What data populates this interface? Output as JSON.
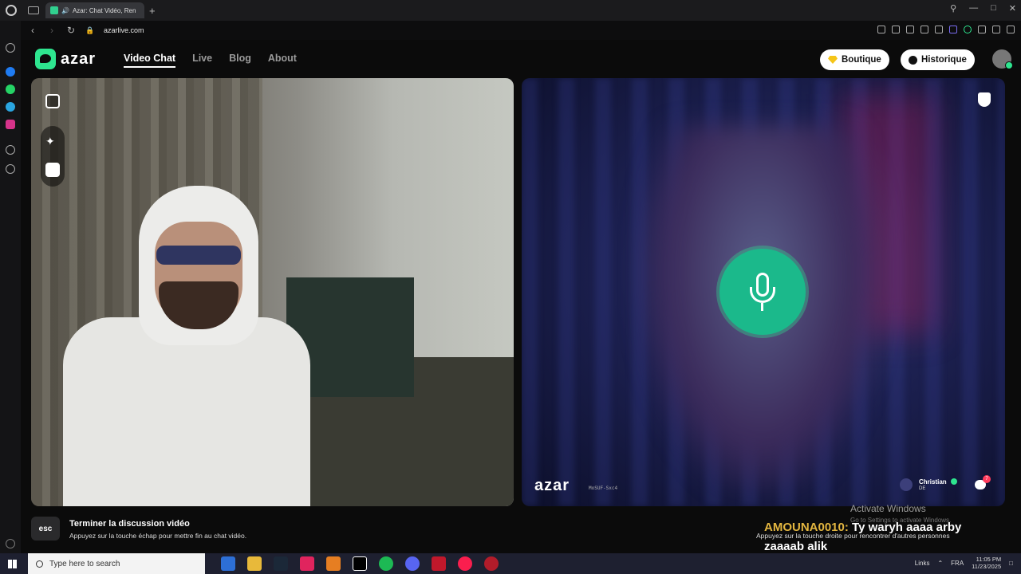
{
  "browser": {
    "tab_title": "Azar: Chat Vidéo, Ren",
    "new_tab": "+",
    "url": "azarlive.com"
  },
  "header": {
    "logo_text": "azar",
    "nav": [
      {
        "label": "Video Chat",
        "active": true
      },
      {
        "label": "Live",
        "active": false
      },
      {
        "label": "Blog",
        "active": false
      },
      {
        "label": "About",
        "active": false
      }
    ],
    "boutique_label": "Boutique",
    "historique_label": "Historique"
  },
  "remote_video": {
    "overlay_logo": "azar",
    "overlay_id": "MoSUF-Sxc4",
    "partner_name": "Christian",
    "partner_country": "DE",
    "chat_badge_count": "7"
  },
  "hints": {
    "esc_key": "esc",
    "end_title": "Terminer la discussion vidéo",
    "end_sub": "Appuyez sur la touche échap pour mettre fin au chat vidéo.",
    "next_sub": "Appuyez sur la touche droite pour rencontrer d'autres personnes"
  },
  "watermark": {
    "title": "Activate Windows",
    "sub": "Go to Settings to activate Windows."
  },
  "stream_chat": {
    "user": "AMOUNA0010:",
    "message": " Ty waryh aaaa arby zaaaab alik"
  },
  "taskbar": {
    "search_placeholder": "Type here to search",
    "links": "Links",
    "language": "FRA",
    "time": "11:05 PM",
    "date": "11/23/2025"
  },
  "colors": {
    "accent": "#2ee58f",
    "mic_button": "#1bb98b",
    "chat_username": "#e3b640"
  },
  "icons": [
    "opera-icon",
    "reload-icon",
    "lock-icon",
    "gem-icon",
    "clock-icon",
    "avatar-icon",
    "crop-icon",
    "sparkle-icon",
    "face-icon",
    "mic-icon",
    "shield-icon",
    "chat-icon",
    "windows-start-icon",
    "search-icon"
  ]
}
